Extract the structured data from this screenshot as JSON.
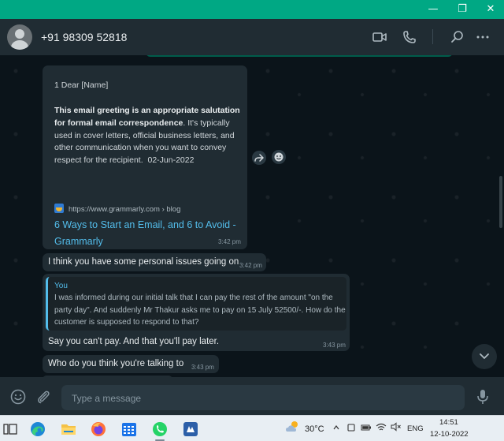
{
  "window": {
    "controls": {
      "minimize": "—",
      "restore": "❐",
      "close": "✕"
    }
  },
  "header": {
    "contact_name": "+91 98309 52818",
    "icons": [
      "video-call-icon",
      "voice-call-icon",
      "search-icon",
      "menu-icon"
    ]
  },
  "messages": {
    "link_card": {
      "line1": "1 Dear [Name]",
      "desc_bold": "This email greeting is an appropriate salutation for formal email correspondence",
      "desc_rest": ". It's typically used in cover letters, official business letters, and other communication when you want to convey respect for the recipient.",
      "desc_date": "02-Jun-2022",
      "url": "https://www.grammarly.com › blog",
      "link_title": "6 Ways to Start an Email, and 6 to Avoid - Grammarly",
      "time": "3:42 pm"
    },
    "msg2": {
      "text": "I think you have some personal issues going on",
      "time": "3:42 pm"
    },
    "msg3": {
      "quote_author": "You",
      "quote_text": "I was informed during our initial talk that I can pay the rest of the amount \"on the party day\". And suddenly Mr Thakur asks me to pay on 15 July 52500/-. How do the customer is supposed to respond to that?",
      "text": "Say you can't pay. And that you'll pay later.",
      "time": "3:43 pm"
    },
    "msg4": {
      "text": "Who do you think you're talking to",
      "time": "3:43 pm"
    }
  },
  "composer": {
    "placeholder": "Type a message",
    "icons": [
      "emoji-icon",
      "attach-icon",
      "mic-icon"
    ]
  },
  "taskbar": {
    "weather": "30°C",
    "language": "ENG",
    "time": "14:51",
    "date": "12-10-2022",
    "apps": [
      "task-view",
      "edge",
      "file-explorer",
      "firefox",
      "calendar",
      "whatsapp",
      "app-icon"
    ]
  },
  "colors": {
    "accent": "#00a884",
    "header_bg": "#202c33",
    "chat_bg": "#0b141a",
    "bubble_in": "#202c33",
    "link": "#53bdeb"
  }
}
